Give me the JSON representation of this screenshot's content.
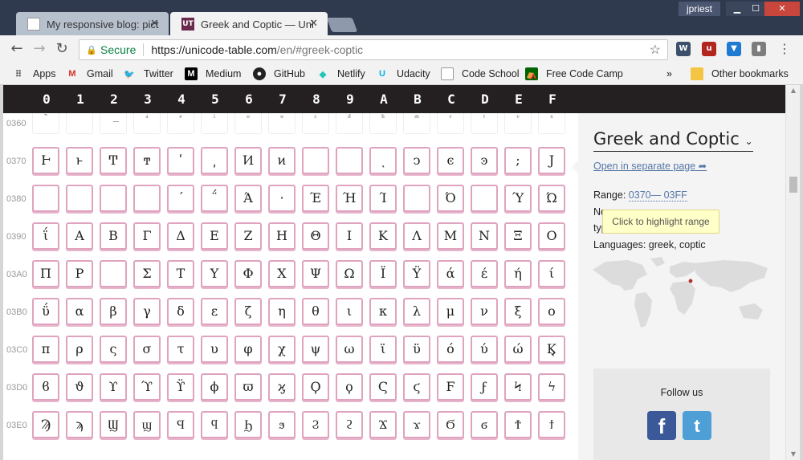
{
  "browser": {
    "tabs": [
      {
        "label": "My responsive blog: pictu",
        "active": false
      },
      {
        "label": "Greek and Coptic — Unic",
        "active": true
      }
    ],
    "user": "jpriest",
    "url": {
      "secure_label": "Secure",
      "host": "https://unicode-table.com",
      "path": "/en/#greek-coptic"
    },
    "bookmarks": [
      {
        "label": "Apps",
        "icon": "apps-grid-icon"
      },
      {
        "label": "Gmail",
        "icon": "gmail-icon"
      },
      {
        "label": "Twitter",
        "icon": "twitter-icon"
      },
      {
        "label": "Medium",
        "icon": "medium-icon"
      },
      {
        "label": "GitHub",
        "icon": "github-icon"
      },
      {
        "label": "Netlify",
        "icon": "netlify-icon"
      },
      {
        "label": "Udacity",
        "icon": "udacity-icon"
      },
      {
        "label": "Code School",
        "icon": "page-icon"
      },
      {
        "label": "Free Code Camp",
        "icon": "freecodecamp-icon"
      }
    ],
    "other_bookmarks": "Other bookmarks",
    "overflow": "»"
  },
  "table": {
    "columns": [
      "0",
      "1",
      "2",
      "3",
      "4",
      "5",
      "6",
      "7",
      "8",
      "9",
      "A",
      "B",
      "C",
      "D",
      "E",
      "F"
    ],
    "partial_row": {
      "label": "0360",
      "chars": [
        "͂",
        "͡",
        "͟",
        "ͣ",
        "ͤ",
        "ͥ",
        "ͦ",
        "ͧ",
        "ͨ",
        "ͩ",
        "ͪ",
        "ͫ",
        "ͬ",
        "ͭ",
        "ͮ",
        "ͯ"
      ]
    },
    "rows": [
      {
        "label": "0370",
        "chars": [
          "Ͱ",
          "ͱ",
          "Ͳ",
          "ͳ",
          "ʹ",
          "͵",
          "Ͷ",
          "ͷ",
          "",
          "",
          "ͺ",
          "ͻ",
          "ͼ",
          "ͽ",
          ";",
          "Ϳ"
        ]
      },
      {
        "label": "0380",
        "chars": [
          "",
          "",
          "",
          "",
          "΄",
          "΅",
          "Ά",
          "·",
          "Έ",
          "Ή",
          "Ί",
          "",
          "Ό",
          "",
          "Ύ",
          "Ώ"
        ]
      },
      {
        "label": "0390",
        "chars": [
          "ΐ",
          "Α",
          "Β",
          "Γ",
          "Δ",
          "Ε",
          "Ζ",
          "Η",
          "Θ",
          "Ι",
          "Κ",
          "Λ",
          "Μ",
          "Ν",
          "Ξ",
          "Ο"
        ]
      },
      {
        "label": "03A0",
        "chars": [
          "Π",
          "Ρ",
          "",
          "Σ",
          "Τ",
          "Υ",
          "Φ",
          "Χ",
          "Ψ",
          "Ω",
          "Ϊ",
          "Ϋ",
          "ά",
          "έ",
          "ή",
          "ί"
        ]
      },
      {
        "label": "03B0",
        "chars": [
          "ΰ",
          "α",
          "β",
          "γ",
          "δ",
          "ε",
          "ζ",
          "η",
          "θ",
          "ι",
          "κ",
          "λ",
          "μ",
          "ν",
          "ξ",
          "ο"
        ]
      },
      {
        "label": "03C0",
        "chars": [
          "π",
          "ρ",
          "ς",
          "σ",
          "τ",
          "υ",
          "φ",
          "χ",
          "ψ",
          "ω",
          "ϊ",
          "ϋ",
          "ό",
          "ύ",
          "ώ",
          "Ϗ"
        ]
      },
      {
        "label": "03D0",
        "chars": [
          "ϐ",
          "ϑ",
          "ϒ",
          "ϓ",
          "ϔ",
          "ϕ",
          "ϖ",
          "ϗ",
          "Ϙ",
          "ϙ",
          "Ϛ",
          "ϛ",
          "Ϝ",
          "ϝ",
          "Ϟ",
          "ϟ"
        ]
      },
      {
        "label": "03E0",
        "chars": [
          "Ϡ",
          "ϡ",
          "Ϣ",
          "ϣ",
          "Ϥ",
          "ϥ",
          "Ϧ",
          "ϧ",
          "Ϩ",
          "ϩ",
          "Ϫ",
          "ϫ",
          "Ϭ",
          "ϭ",
          "Ϯ",
          "ϯ"
        ]
      }
    ]
  },
  "sidepanel": {
    "title": "Greek and Coptic",
    "open_link": "Open in separate page",
    "range_label": "Range:",
    "range_value": "0370— 03FF",
    "tooltip": "Click to highlight range",
    "line_no": "No",
    "line_typ": "typ",
    "languages": "Languages: greek, coptic",
    "follow": "Follow us",
    "facebook_glyph": "f",
    "twitter_glyph": "t"
  },
  "colors": {
    "header_bg": "#242021",
    "cell_border": "#e0a3bf",
    "link": "#5577a6",
    "facebook": "#3b5998",
    "twitter": "#4d9fd6"
  }
}
